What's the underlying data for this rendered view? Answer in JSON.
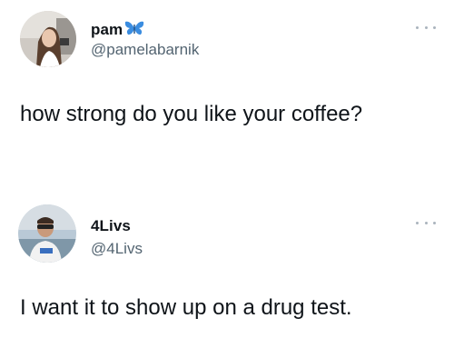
{
  "tweets": [
    {
      "display_name": "pam",
      "name_emoji": "blue-butterfly-icon",
      "handle": "@pamelabarnik",
      "text": "how strong do you like your coffee?",
      "menu_icon": "more-options-icon"
    },
    {
      "display_name": "4Livs",
      "handle": "@4Livs",
      "text": "I want it to show up on a drug test.",
      "menu_icon": "more-options-icon"
    }
  ],
  "colors": {
    "text": "#0f1419",
    "secondary_text": "#536471",
    "butterfly": "#3b8de0",
    "menu_dots": "#aab4bd"
  }
}
